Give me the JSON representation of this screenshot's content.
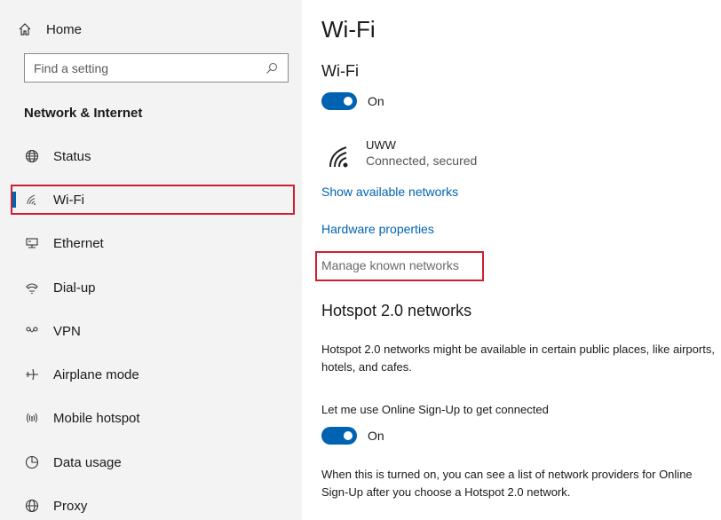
{
  "sidebar": {
    "home_label": "Home",
    "search_placeholder": "Find a setting",
    "section_title": "Network & Internet",
    "items": [
      {
        "label": "Status",
        "icon": "globe-icon"
      },
      {
        "label": "Wi-Fi",
        "icon": "wifi-icon",
        "selected": true
      },
      {
        "label": "Ethernet",
        "icon": "ethernet-icon"
      },
      {
        "label": "Dial-up",
        "icon": "dialup-icon"
      },
      {
        "label": "VPN",
        "icon": "vpn-icon"
      },
      {
        "label": "Airplane mode",
        "icon": "airplane-icon"
      },
      {
        "label": "Mobile hotspot",
        "icon": "hotspot-icon"
      },
      {
        "label": "Data usage",
        "icon": "data-usage-icon"
      },
      {
        "label": "Proxy",
        "icon": "globe-icon"
      }
    ]
  },
  "main": {
    "title": "Wi-Fi",
    "wifi_section_title": "Wi-Fi",
    "wifi_toggle_state": "On",
    "network": {
      "name": "UWW",
      "status": "Connected, secured"
    },
    "links": {
      "show_available": "Show available networks",
      "hardware_properties": "Hardware properties",
      "manage_known": "Manage known networks"
    },
    "hotspot": {
      "title": "Hotspot 2.0 networks",
      "description": "Hotspot 2.0 networks might be available in certain public places, like airports, hotels, and cafes.",
      "signup_label": "Let me use Online Sign-Up to get connected",
      "signup_toggle_state": "On",
      "footnote": "When this is turned on, you can see a list of network providers for Online Sign-Up after you choose a Hotspot 2.0 network."
    }
  },
  "colors": {
    "accent": "#0063b1",
    "highlight_box": "#cc2030",
    "sidebar_bg": "#f3f3f3"
  }
}
